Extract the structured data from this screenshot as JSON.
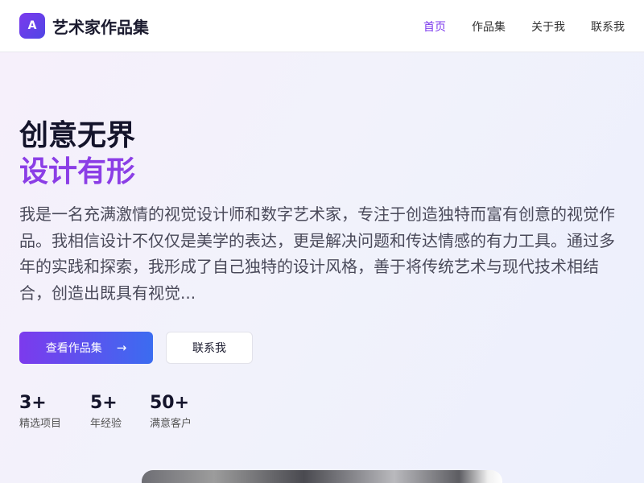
{
  "brand": {
    "logo_letter": "A",
    "name": "艺术家作品集"
  },
  "nav": {
    "items": [
      "首页",
      "作品集",
      "关于我",
      "联系我"
    ],
    "active_index": 0
  },
  "hero": {
    "title_line1": "创意无界",
    "title_line2": "设计有形",
    "description": "我是一名充满激情的视觉设计师和数字艺术家，专注于创造独特而富有创意的视觉作品。我相信设计不仅仅是美学的表达，更是解决问题和传达情感的有力工具。通过多年的实践和探索，我形成了自己独特的设计风格，善于将传统艺术与现代技术相结合，创造出既具有视觉...",
    "primary_button": "查看作品集",
    "secondary_button": "联系我"
  },
  "stats": [
    {
      "value": "3+",
      "label": "精选项目"
    },
    {
      "value": "5+",
      "label": "年经验"
    },
    {
      "value": "50+",
      "label": "满意客户"
    }
  ],
  "colors": {
    "accent": "#7c3aed",
    "accent_blue": "#3b6cf0",
    "title": "#14142b"
  },
  "icons": {
    "primary_button_icon": "arrow-right-icon"
  }
}
